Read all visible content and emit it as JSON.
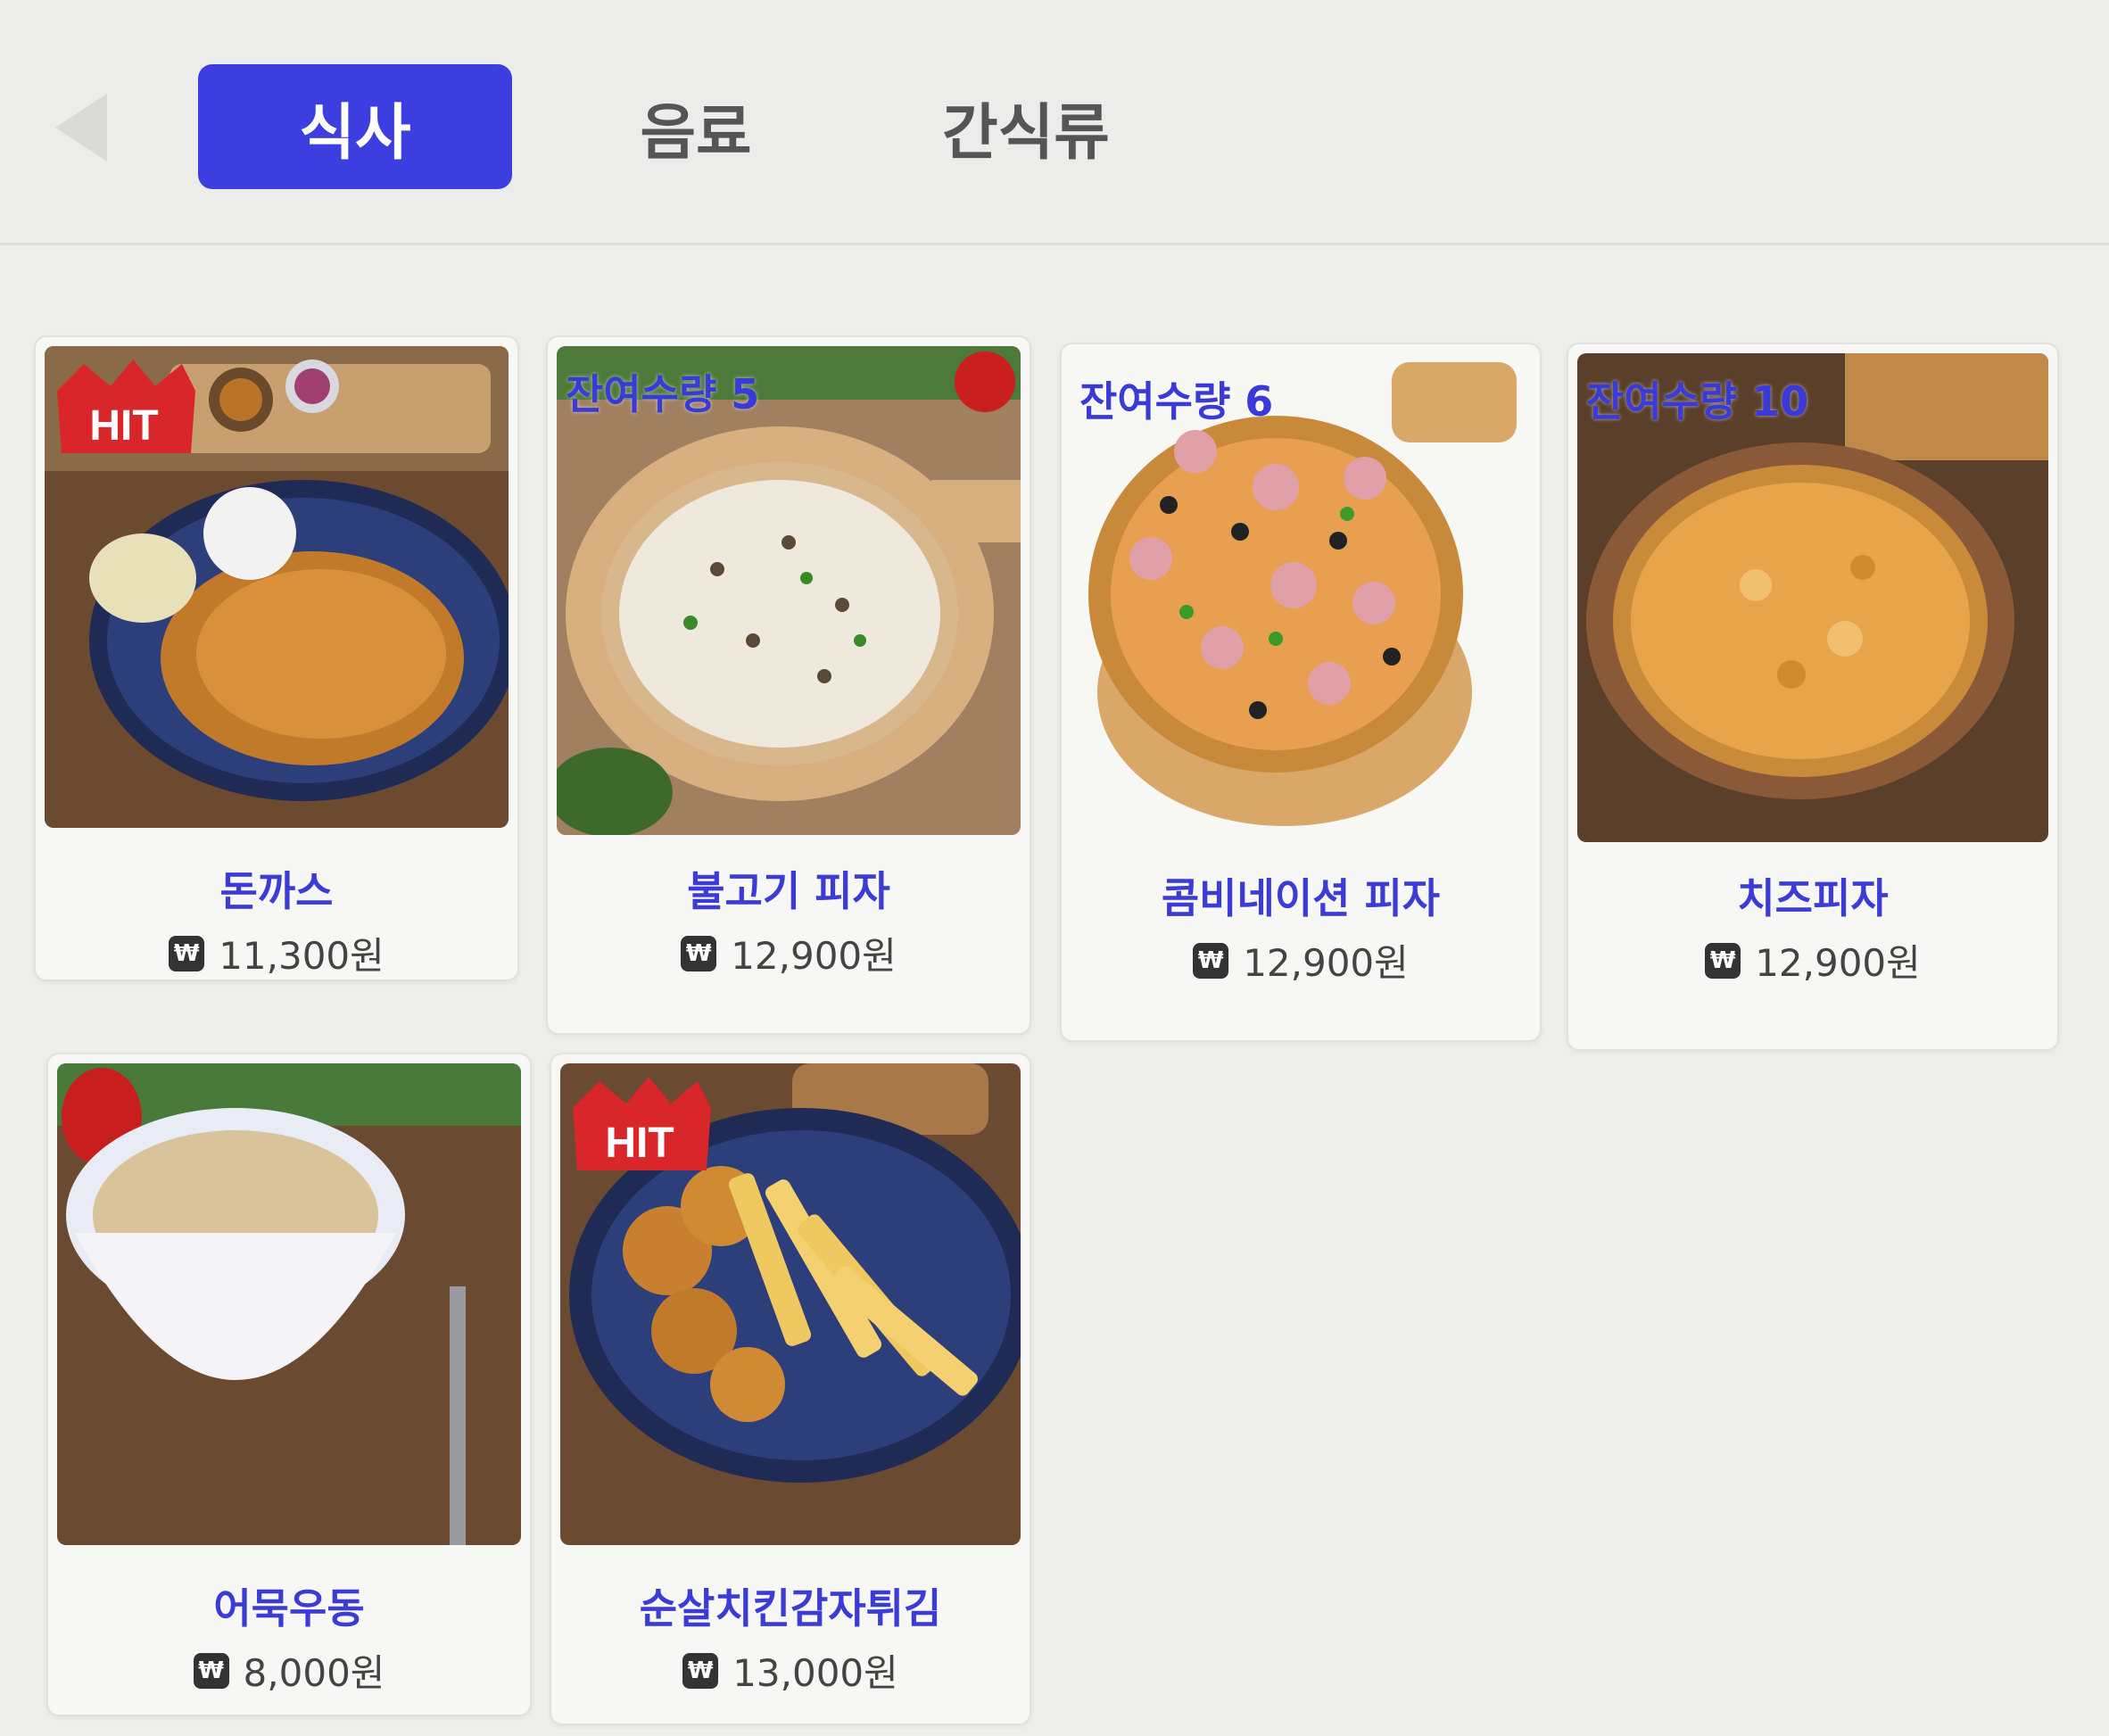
{
  "tabs": [
    {
      "label": "식사",
      "active": true
    },
    {
      "label": "음료",
      "active": false
    },
    {
      "label": "간식류",
      "active": false
    }
  ],
  "currency_icon": "₩",
  "badge": {
    "hit_label": "HIT"
  },
  "menu_items": [
    {
      "name": "돈까스",
      "price": "11,300원",
      "badge": "HIT",
      "stock_label": ""
    },
    {
      "name": "불고기 피자",
      "price": "12,900원",
      "badge": "",
      "stock_label": "잔여수량 5"
    },
    {
      "name": "콤비네이션 피자",
      "price": "12,900원",
      "badge": "",
      "stock_label": "잔여수량 6"
    },
    {
      "name": "치즈피자",
      "price": "12,900원",
      "badge": "",
      "stock_label": "잔여수량 10"
    },
    {
      "name": "어묵우동",
      "price": "8,000원",
      "badge": "",
      "stock_label": ""
    },
    {
      "name": "순살치킨감자튀김",
      "price": "13,000원",
      "badge": "HIT",
      "stock_label": ""
    }
  ],
  "colors": {
    "accent": "#3d3ee0",
    "item_name": "#3b3bd6"
  }
}
